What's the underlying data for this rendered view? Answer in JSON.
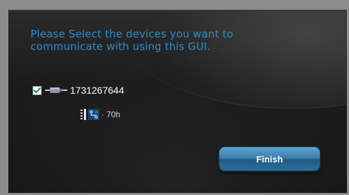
{
  "dialog": {
    "instruction": "Please Select the devices you want to communicate with using this GUI."
  },
  "devices": [
    {
      "id": "1731267644",
      "checked": true,
      "icon": "usb-plug-icon",
      "status_icons": [
        "signal-strength-icon",
        "network-icon"
      ],
      "status_text": "· 70h"
    }
  ],
  "actions": {
    "finish_label": "Finish"
  },
  "colors": {
    "instruction_text": "#2a8fd0",
    "button_accent": "#3b7fae",
    "background": "#1b1b1b",
    "checkmark": "#1f9a2e"
  }
}
